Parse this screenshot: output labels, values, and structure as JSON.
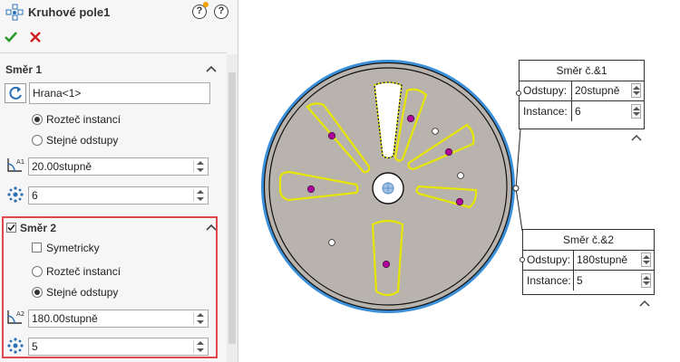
{
  "window": {
    "title": "Kruhové pole1"
  },
  "header": {
    "help_icon": "help-icon",
    "tip_icon": "tip-icon"
  },
  "actions": {
    "ok_icon": "check-icon",
    "cancel_icon": "close-icon"
  },
  "direction1": {
    "title": "Směr 1",
    "edge_value": "Hrana<1>",
    "option_instance_spacing": "Rozteč instancí",
    "option_equal_spacing": "Stejné odstupy",
    "selected": "instance_spacing",
    "angle_value": "20.00stupně",
    "count_value": "6"
  },
  "direction2": {
    "title": "Směr 2",
    "checked": true,
    "symmetric_label": "Symetricky",
    "symmetric_checked": false,
    "option_instance_spacing": "Rozteč instancí",
    "option_equal_spacing": "Stejné odstupy",
    "selected": "equal_spacing",
    "angle_value": "180.00stupně",
    "count_value": "5"
  },
  "callout1": {
    "title": "Směr č.&1",
    "spacing_label": "Odstupy:",
    "spacing_value": "20stupně",
    "instances_label": "Instance:",
    "instances_value": "6"
  },
  "callout2": {
    "title": "Směr č.&2",
    "spacing_label": "Odstupy:",
    "spacing_value": "180stupně",
    "instances_label": "Instance:",
    "instances_value": "5"
  },
  "colors": {
    "highlight_box": "#e0484e",
    "disk_fill": "#b9b3ad",
    "disk_rim": "#3a8fd8",
    "preview_outline": "#e6e600",
    "point_magenta": "#b0009a",
    "ok_green": "#2a9a2a",
    "cancel_red": "#d02020"
  }
}
